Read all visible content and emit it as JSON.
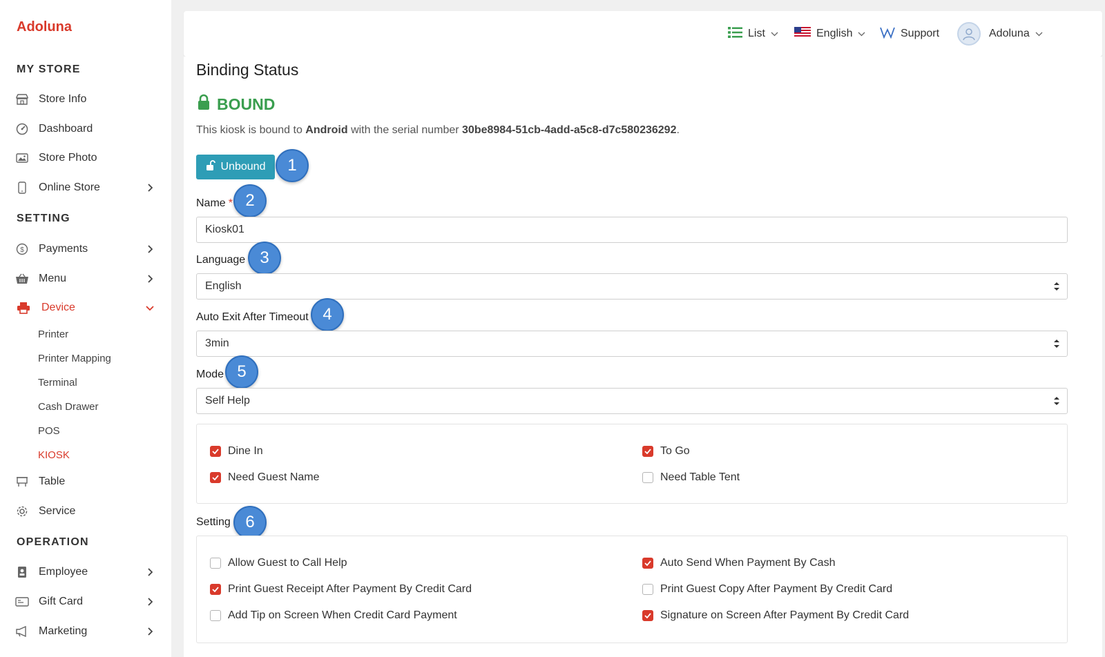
{
  "brand": "Adoluna",
  "sidebar": {
    "sections": {
      "my_store": "MY STORE",
      "setting": "SETTING",
      "operation": "OPERATION"
    },
    "items": {
      "store_info": "Store Info",
      "dashboard": "Dashboard",
      "store_photo": "Store Photo",
      "online_store": "Online Store",
      "payments": "Payments",
      "menu": "Menu",
      "device": "Device",
      "table": "Table",
      "service": "Service",
      "employee": "Employee",
      "gift_card": "Gift Card",
      "marketing": "Marketing"
    },
    "device_sub": {
      "printer": "Printer",
      "printer_mapping": "Printer Mapping",
      "terminal": "Terminal",
      "cash_drawer": "Cash Drawer",
      "pos": "POS",
      "kiosk": "KIOSK"
    }
  },
  "header": {
    "list": "List",
    "language": "English",
    "support": "Support",
    "user": "Adoluna"
  },
  "main": {
    "title": "Binding Status",
    "status": "BOUND",
    "desc_prefix": "This kiosk is bound to ",
    "desc_device": "Android",
    "desc_mid": " with the serial number ",
    "desc_serial": "30be8984-51cb-4add-a5c8-d7c580236292",
    "desc_suffix": ".",
    "unbound_button": "Unbound",
    "name_label": "Name",
    "name_required": "*",
    "name_value": "Kiosk01",
    "language_label": "Language",
    "language_value": "English",
    "timeout_label": "Auto Exit After Timeout",
    "timeout_value": "3min",
    "mode_label": "Mode",
    "mode_value": "Self Help",
    "setting_label": "Setting"
  },
  "badges": [
    "1",
    "2",
    "3",
    "4",
    "5",
    "6"
  ],
  "order_options": [
    {
      "label": "Dine In",
      "checked": true
    },
    {
      "label": "To Go",
      "checked": true
    },
    {
      "label": "Need Guest Name",
      "checked": true
    },
    {
      "label": "Need Table Tent",
      "checked": false
    }
  ],
  "settings_options": [
    {
      "label": "Allow Guest to Call Help",
      "checked": false
    },
    {
      "label": "Auto Send When Payment By Cash",
      "checked": true
    },
    {
      "label": "Print Guest Receipt After Payment By Credit Card",
      "checked": true
    },
    {
      "label": "Print Guest Copy After Payment By Credit Card",
      "checked": false
    },
    {
      "label": "Add Tip on Screen When Credit Card Payment",
      "checked": false
    },
    {
      "label": "Signature on Screen After Payment By Credit Card",
      "checked": true
    }
  ],
  "colors": {
    "brand_red": "#d93a2b",
    "bound_green": "#3a9e4f",
    "button_teal": "#2e9db6",
    "badge_blue": "#4a8ad6"
  }
}
